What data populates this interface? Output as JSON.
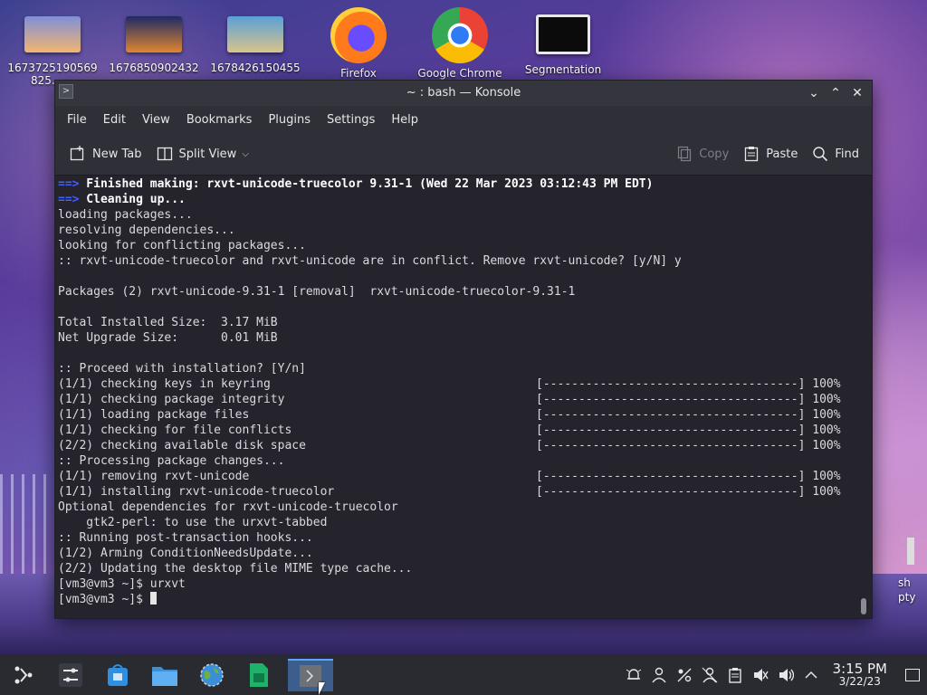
{
  "desktop": {
    "icons": [
      {
        "label": "1673725190569",
        "label2": "825...",
        "type": "image",
        "colors": [
          "#7f8fd8",
          "#f2b56f"
        ]
      },
      {
        "label": "1676850902432",
        "type": "image",
        "colors": [
          "#1d2a66",
          "#e0862f"
        ]
      },
      {
        "label": "1678426150455",
        "type": "image",
        "colors": [
          "#5aa0d8",
          "#d8c48a"
        ]
      },
      {
        "label": "Firefox",
        "type": "app",
        "icon": "firefox-icon"
      },
      {
        "label": "Google Chrome",
        "type": "app",
        "icon": "chrome-icon"
      },
      {
        "label": "Segmentation",
        "type": "file",
        "icon": "video-file-icon"
      }
    ],
    "side_partial": {
      "label1": "sh",
      "label2": "pty"
    }
  },
  "window": {
    "title": "~ : bash — Konsole",
    "app_icon": "terminal-icon",
    "buttons": {
      "minimize": "minimize-icon",
      "maximize": "maximize-icon",
      "close": "close-icon"
    },
    "menu": [
      "File",
      "Edit",
      "View",
      "Bookmarks",
      "Plugins",
      "Settings",
      "Help"
    ],
    "toolbar": {
      "new_tab": "New Tab",
      "split_view": "Split View",
      "copy": "Copy",
      "paste": "Paste",
      "find": "Find"
    }
  },
  "terminal": {
    "lines": [
      {
        "arrow": "==>",
        "text": " Finished making: rxvt-unicode-truecolor 9.31-1 (Wed 22 Mar 2023 03:12:43 PM EDT)",
        "bold": true
      },
      {
        "arrow": "==>",
        "text": " Cleaning up...",
        "bold": true
      },
      {
        "text": "loading packages..."
      },
      {
        "text": "resolving dependencies..."
      },
      {
        "text": "looking for conflicting packages..."
      },
      {
        "text": ":: rxvt-unicode-truecolor and rxvt-unicode are in conflict. Remove rxvt-unicode? [y/N] y"
      },
      {
        "text": ""
      },
      {
        "text": "Packages (2) rxvt-unicode-9.31-1 [removal]  rxvt-unicode-truecolor-9.31-1"
      },
      {
        "text": ""
      },
      {
        "text": "Total Installed Size:  3.17 MiB"
      },
      {
        "text": "Net Upgrade Size:      0.01 MiB"
      },
      {
        "text": ""
      },
      {
        "text": ":: Proceed with installation? [Y/n]"
      },
      {
        "text": "(1/1) checking keys in keyring",
        "bar": "[------------------------------------] 100%"
      },
      {
        "text": "(1/1) checking package integrity",
        "bar": "[------------------------------------] 100%"
      },
      {
        "text": "(1/1) loading package files",
        "bar": "[------------------------------------] 100%"
      },
      {
        "text": "(1/1) checking for file conflicts",
        "bar": "[------------------------------------] 100%"
      },
      {
        "text": "(2/2) checking available disk space",
        "bar": "[------------------------------------] 100%"
      },
      {
        "text": ":: Processing package changes..."
      },
      {
        "text": "(1/1) removing rxvt-unicode",
        "bar": "[------------------------------------] 100%"
      },
      {
        "text": "(1/1) installing rxvt-unicode-truecolor",
        "bar": "[------------------------------------] 100%"
      },
      {
        "text": "Optional dependencies for rxvt-unicode-truecolor"
      },
      {
        "text": "    gtk2-perl: to use the urxvt-tabbed"
      },
      {
        "text": ":: Running post-transaction hooks..."
      },
      {
        "text": "(1/2) Arming ConditionNeedsUpdate..."
      },
      {
        "text": "(2/2) Updating the desktop file MIME type cache..."
      },
      {
        "text": "[vm3@vm3 ~]$ urxvt"
      },
      {
        "text": "[vm3@vm3 ~]$ ",
        "cursor": true
      }
    ]
  },
  "taskbar": {
    "items": [
      {
        "name": "app-launcher",
        "icon": "app-launcher-icon"
      },
      {
        "name": "settings-mixer",
        "icon": "sliders-icon"
      },
      {
        "name": "discover-store",
        "icon": "store-icon"
      },
      {
        "name": "file-manager",
        "icon": "folder-icon"
      },
      {
        "name": "web-browser",
        "icon": "globe-icon"
      },
      {
        "name": "spreadsheet",
        "icon": "document-icon"
      },
      {
        "name": "konsole",
        "icon": "terminal-icon",
        "active": true
      }
    ],
    "tray": [
      "notifications-icon",
      "user-icon",
      "network-icon",
      "user-switch-icon",
      "clipboard-icon",
      "mute-icon",
      "volume-icon",
      "expand-tray-icon"
    ],
    "clock": {
      "time": "3:15 PM",
      "date": "3/22/23"
    },
    "show_desktop_icon": "show-desktop-icon"
  },
  "colors": {
    "terminal_bg": "#25242d",
    "arrow": "#3f5fff",
    "accent": "#5fa2ff"
  }
}
